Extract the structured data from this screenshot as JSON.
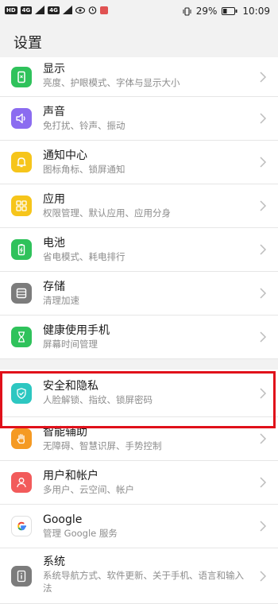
{
  "status_bar": {
    "left_chips": [
      "HD",
      "4G",
      "4G"
    ],
    "battery": "29%",
    "time": "10:09"
  },
  "page_title": "设置",
  "colors": {
    "highlight_border": "#e0101a",
    "display": "#2fc25b",
    "sound": "#8b6cf0",
    "notification": "#f6c51b",
    "apps": "#f6c51b",
    "battery": "#2fc25b",
    "storage": "#7c7c7c",
    "digital_balance": "#2fc25b",
    "security": "#2dc7c1",
    "accessibility": "#f59a23",
    "users": "#f25b5b",
    "google": "#ffffff",
    "system": "#7c7c7c"
  },
  "settings": [
    {
      "label": "显示",
      "subtitle": "亮度、护眼模式、字体与显示大小",
      "icon": "display-icon"
    },
    {
      "label": "声音",
      "subtitle": "免打扰、铃声、振动",
      "icon": "speaker-icon"
    },
    {
      "label": "通知中心",
      "subtitle": "图标角标、锁屏通知",
      "icon": "bell-icon"
    },
    {
      "label": "应用",
      "subtitle": "权限管理、默认应用、应用分身",
      "icon": "apps-grid-icon"
    },
    {
      "label": "电池",
      "subtitle": "省电模式、耗电排行",
      "icon": "battery-icon"
    },
    {
      "label": "存储",
      "subtitle": "清理加速",
      "icon": "storage-icon"
    },
    {
      "label": "健康使用手机",
      "subtitle": "屏幕时间管理",
      "icon": "hourglass-icon"
    },
    {
      "label": "安全和隐私",
      "subtitle": "人脸解锁、指纹、锁屏密码",
      "icon": "shield-icon"
    },
    {
      "label": "智能辅助",
      "subtitle": "无障碍、智慧识屏、手势控制",
      "icon": "hand-icon"
    },
    {
      "label": "用户和帐户",
      "subtitle": "多用户、云空间、帐户",
      "icon": "user-icon"
    },
    {
      "label": "Google",
      "subtitle": "管理 Google 服务",
      "icon": "google-icon"
    },
    {
      "label": "系统",
      "subtitle": "系统导航方式、软件更新、关于手机、语言和输入法",
      "icon": "system-info-icon"
    }
  ]
}
